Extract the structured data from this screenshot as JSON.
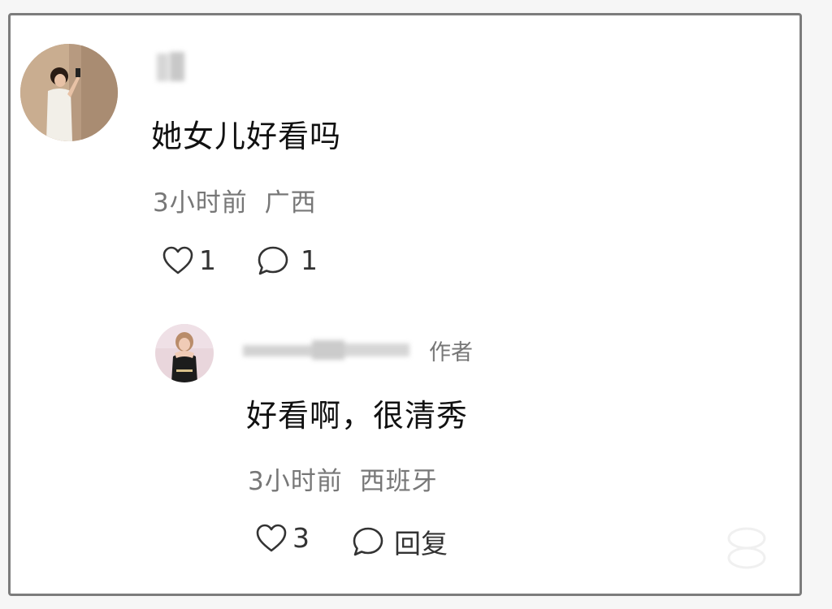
{
  "comment": {
    "text": "她女儿好看吗",
    "time": "3小时前",
    "location": "广西",
    "likes": "1",
    "replies": "1"
  },
  "reply": {
    "author_tag": "作者",
    "text": "好看啊，很清秀",
    "time": "3小时前",
    "location": "西班牙",
    "likes": "3",
    "reply_label": "回复"
  },
  "icons": {
    "like": "heart-outline-icon",
    "comment": "speech-bubble-icon"
  },
  "colors": {
    "text": "#111111",
    "meta": "#777777",
    "frame": "#7c7c7c"
  }
}
